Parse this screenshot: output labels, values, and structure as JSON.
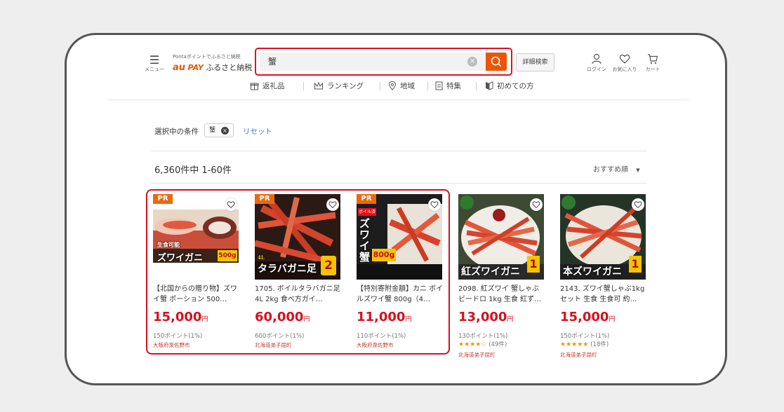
{
  "header": {
    "menu_label": "メニュー",
    "logo_sub": "Pontaポイントでふるさと納税",
    "logo_au": "au",
    "logo_pay": "PAY",
    "logo_text": "ふるさと納税",
    "search_value": "蟹",
    "detail_search": "詳細検索",
    "login": "ログイン",
    "favorites": "お気に入り",
    "cart": "カート"
  },
  "nav": [
    "返礼品",
    "ランキング",
    "地域",
    "特集",
    "初めての方"
  ],
  "conditions": {
    "label": "選択中の条件",
    "chip": "蟹",
    "reset": "リセット"
  },
  "results": {
    "count": "6,360件中 1-60件",
    "sort": "おすすめ順"
  },
  "products": [
    {
      "pr": "PR",
      "title": "【北国からの贈り物】ズワイ蟹 ポーション 500…",
      "price": "15,000",
      "yen": "円",
      "points": "150ポイント(1%)",
      "location": "大阪府泉佐野市",
      "img_text": "ズワイガニ",
      "img_badge": "500g",
      "img_note": "生食可能"
    },
    {
      "pr": "PR",
      "title": "1705. ボイルタラバガニ足 4L 2kg 食べ方ガイ…",
      "price": "60,000",
      "yen": "円",
      "points": "600ポイント(1%)",
      "location": "北海道弟子屈町",
      "img_text": "タラバガニ足",
      "img_badge": "2",
      "img_note": "4L"
    },
    {
      "pr": "PR",
      "title": "【特別寄附金額】カニ ボイルズワイ蟹 800g（4…",
      "price": "11,000",
      "yen": "円",
      "points": "110ポイント(1%)",
      "location": "大阪府泉佐野市",
      "img_text": "ズワイ蟹",
      "img_badge": "800g",
      "img_note": "ボイル済"
    },
    {
      "title": "2098. 紅ズワイ 蟹しゃぶ ビードロ 1kg 生食 紅ず…",
      "price": "13,000",
      "yen": "円",
      "points": "130ポイント(1%)",
      "stars": "★★★★☆",
      "reviews": "(49件)",
      "location": "北海道弟子屈町",
      "img_text": "紅ズワイガニ",
      "img_badge": "1"
    },
    {
      "title": "2143. ズワイ蟹しゃぶ1kgセット 生食 生食可 約…",
      "price": "15,000",
      "yen": "円",
      "points": "150ポイント(1%)",
      "stars": "★★★★★",
      "reviews": "(18件)",
      "location": "北海道弟子屈町",
      "img_text": "本ズワイガニ",
      "img_badge": "1"
    }
  ],
  "colors": {
    "accent": "#eb5505",
    "price": "#d8101c",
    "highlight": "#d8101c",
    "link": "#3b7ccf"
  }
}
